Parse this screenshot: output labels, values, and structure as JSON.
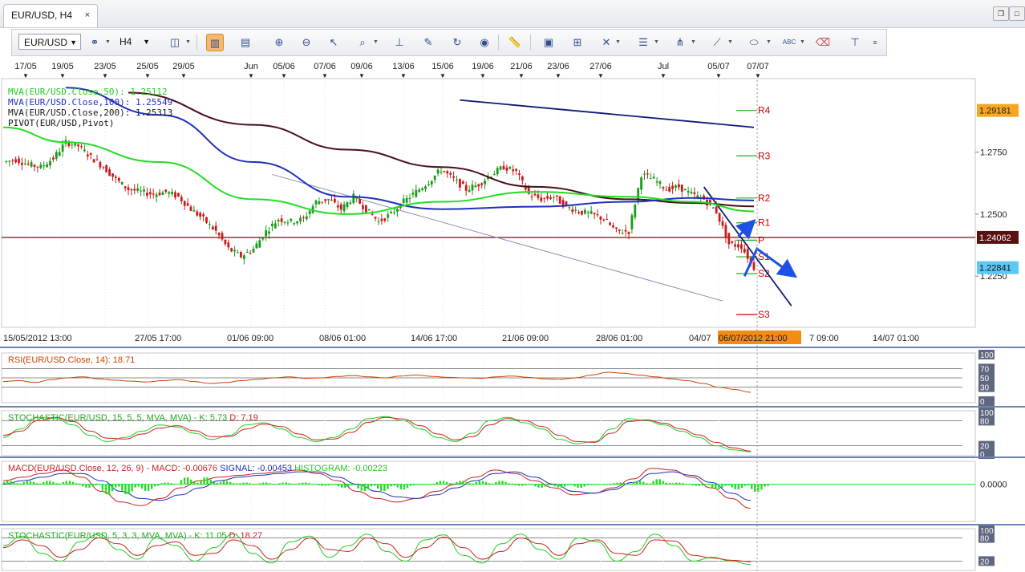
{
  "window": {
    "tab_title": "EUR/USD, H4",
    "close_glyph": "×"
  },
  "toolbar": {
    "symbol": "EUR/USD",
    "timeframe": "H4"
  },
  "colors": {
    "bull": "#1a9a1a",
    "bear": "#cc1a1a",
    "ma50": "#22dd22",
    "ma100": "#1f2fc0",
    "ma200": "#4a0f1a",
    "pivot_level": "#cc0000",
    "trend_dark": "#0c1a78",
    "arrow": "#1e50e6",
    "current_price_bg": "#5bc8f5",
    "pivot_price_bg": "#5a1010",
    "r4_price_bg": "#f6a623",
    "date_highlight": "#f28c14"
  },
  "chart_data": [
    {
      "type": "candlestick",
      "title": "EUR/USD, H4",
      "ylim": [
        1.205,
        1.304
      ],
      "x_axis_top_labels": [
        "17/05",
        "19/05",
        "23/05",
        "25/05",
        "29/05",
        "Jun",
        "05/06",
        "07/06",
        "09/06",
        "13/06",
        "15/06",
        "19/06",
        "21/06",
        "23/06",
        "27/06",
        "Jul",
        "05/07",
        "07/07"
      ],
      "x_axis_bottom_labels": [
        "15/05/2012 13:00",
        "27/05 17:00",
        "01/06 09:00",
        "08/06 01:00",
        "14/06 17:00",
        "21/06 09:00",
        "28/06 01:00",
        "04/07",
        "06/07/2012 21:00",
        "7 09:00",
        "14/07 01:00"
      ],
      "y_ticks": [
        "1.2750",
        "1.2500",
        "1.2250"
      ],
      "price_labels": {
        "r4_level": "1.29181",
        "pivot": "1.24062",
        "current": "1.22841"
      },
      "legend": [
        {
          "label": "MVA(EUR/USD.Close,50): 1.25112",
          "color": "#22cc22"
        },
        {
          "label": "MVA(EUR/USD.Close,100): 1.25549",
          "color": "#1f2fc0"
        },
        {
          "label": "MVA(EUR/USD.Close,200): 1.25313",
          "color": "#1a1a1a"
        },
        {
          "label": "PIVOT(EUR/USD,Pivot)",
          "color": "#111111"
        }
      ],
      "pivot_levels": [
        {
          "name": "R4",
          "value": 1.2918
        },
        {
          "name": "R3",
          "value": 1.2735
        },
        {
          "name": "R2",
          "value": 1.2565
        },
        {
          "name": "R1",
          "value": 1.2465
        },
        {
          "name": "P",
          "value": 1.2395
        },
        {
          "name": "S1",
          "value": 1.2328
        },
        {
          "name": "S2",
          "value": 1.226
        },
        {
          "name": "S3",
          "value": 1.2095
        }
      ],
      "close_path": [
        [
          0,
          1.271
        ],
        [
          4,
          1.272
        ],
        [
          8,
          1.27
        ],
        [
          12,
          1.269
        ],
        [
          16,
          1.2725
        ],
        [
          20,
          1.279
        ],
        [
          24,
          1.2775
        ],
        [
          28,
          1.273
        ],
        [
          32,
          1.269
        ],
        [
          36,
          1.264
        ],
        [
          40,
          1.26
        ],
        [
          44,
          1.259
        ],
        [
          48,
          1.258
        ],
        [
          52,
          1.259
        ],
        [
          56,
          1.257
        ],
        [
          60,
          1.252
        ],
        [
          64,
          1.248
        ],
        [
          68,
          1.243
        ],
        [
          72,
          1.236
        ],
        [
          76,
          1.233
        ],
        [
          80,
          1.236
        ],
        [
          84,
          1.243
        ],
        [
          88,
          1.248
        ],
        [
          92,
          1.247
        ],
        [
          96,
          1.248
        ],
        [
          100,
          1.255
        ],
        [
          104,
          1.256
        ],
        [
          108,
          1.252
        ],
        [
          112,
          1.257
        ],
        [
          116,
          1.252
        ],
        [
          120,
          1.247
        ],
        [
          124,
          1.25
        ],
        [
          128,
          1.255
        ],
        [
          132,
          1.259
        ],
        [
          136,
          1.263
        ],
        [
          140,
          1.268
        ],
        [
          144,
          1.264
        ],
        [
          148,
          1.26
        ],
        [
          152,
          1.262
        ],
        [
          156,
          1.266
        ],
        [
          160,
          1.269
        ],
        [
          164,
          1.267
        ],
        [
          168,
          1.258
        ],
        [
          172,
          1.256
        ],
        [
          176,
          1.257
        ],
        [
          180,
          1.253
        ],
        [
          184,
          1.251
        ],
        [
          188,
          1.25
        ],
        [
          192,
          1.248
        ],
        [
          196,
          1.243
        ],
        [
          200,
          1.243
        ],
        [
          204,
          1.266
        ],
        [
          208,
          1.264
        ],
        [
          212,
          1.26
        ],
        [
          216,
          1.261
        ],
        [
          220,
          1.258
        ],
        [
          224,
          1.256
        ],
        [
          228,
          1.251
        ],
        [
          232,
          1.238
        ],
        [
          236,
          1.237
        ],
        [
          240,
          1.2284
        ]
      ],
      "ma50_path": [
        [
          0,
          1.285
        ],
        [
          20,
          1.279
        ],
        [
          50,
          1.271
        ],
        [
          80,
          1.256
        ],
        [
          110,
          1.25
        ],
        [
          140,
          1.255
        ],
        [
          170,
          1.259
        ],
        [
          200,
          1.257
        ],
        [
          220,
          1.255
        ],
        [
          240,
          1.2511
        ]
      ],
      "ma100_path": [
        [
          20,
          1.301
        ],
        [
          50,
          1.29
        ],
        [
          80,
          1.271
        ],
        [
          110,
          1.257
        ],
        [
          140,
          1.252
        ],
        [
          170,
          1.253
        ],
        [
          200,
          1.255
        ],
        [
          220,
          1.2565
        ],
        [
          240,
          1.2555
        ]
      ],
      "ma200_path": [
        [
          40,
          1.299
        ],
        [
          80,
          1.286
        ],
        [
          110,
          1.276
        ],
        [
          140,
          1.269
        ],
        [
          170,
          1.261
        ],
        [
          200,
          1.256
        ],
        [
          220,
          1.2545
        ],
        [
          240,
          1.2531
        ]
      ],
      "annotations": [
        {
          "type": "line",
          "from": [
            86,
            1.266
          ],
          "to": [
            230,
            1.215
          ],
          "color": "#8892b0"
        },
        {
          "type": "line",
          "from": [
            146,
            1.296
          ],
          "to": [
            240,
            1.285
          ],
          "color": "#0c1a78"
        },
        {
          "type": "line",
          "from": [
            224,
            1.261
          ],
          "to": [
            252,
            1.213
          ],
          "color": "#0c1a78"
        },
        {
          "type": "arrow",
          "points": [
            [
              235,
              1.241
            ],
            [
              239,
              1.246
            ]
          ],
          "color": "#1e50e6"
        },
        {
          "type": "arrow",
          "points": [
            [
              237,
              1.225
            ],
            [
              241,
              1.236
            ],
            [
              252,
              1.226
            ]
          ],
          "color": "#1e50e6"
        }
      ]
    },
    {
      "type": "line",
      "title": "RSI(EUR/USD.Close, 14): 18.71",
      "color": "#cc4400",
      "ylim": [
        0,
        100
      ],
      "y_ticks": [
        "100",
        "70",
        "50",
        "30",
        "0"
      ],
      "levels": [
        70,
        50,
        30
      ],
      "values": [
        42,
        44,
        40,
        46,
        50,
        52,
        48,
        45,
        43,
        41,
        44,
        46,
        42,
        38,
        40,
        44,
        47,
        50,
        52,
        49,
        50,
        53,
        55,
        52,
        50,
        54,
        56,
        53,
        51,
        50,
        49,
        52,
        54,
        51,
        48,
        47,
        50,
        56,
        62,
        60,
        56,
        52,
        48,
        44,
        38,
        30,
        25,
        18.71
      ]
    },
    {
      "type": "line",
      "title_parts": {
        "name": "STOCHASTIC(EUR/USD, 15, 5, 5, MVA, MVA) - ",
        "k": "K: 5.73",
        "d": "D: 7.19"
      },
      "ylim": [
        0,
        100
      ],
      "y_ticks": [
        "100",
        "80",
        "20",
        "0"
      ],
      "levels": [
        80,
        20
      ],
      "series": [
        {
          "name": "K",
          "color": "#22cc22",
          "values": [
            40,
            60,
            88,
            85,
            70,
            45,
            30,
            40,
            55,
            70,
            65,
            50,
            35,
            45,
            70,
            75,
            60,
            40,
            30,
            40,
            60,
            85,
            90,
            80,
            60,
            40,
            30,
            50,
            80,
            88,
            75,
            60,
            35,
            25,
            30,
            60,
            85,
            80,
            70,
            55,
            40,
            20,
            10,
            5.73
          ]
        },
        {
          "name": "D",
          "color": "#cc2222",
          "values": [
            45,
            55,
            80,
            88,
            78,
            55,
            38,
            36,
            48,
            62,
            68,
            56,
            42,
            42,
            60,
            72,
            66,
            48,
            34,
            36,
            52,
            76,
            88,
            84,
            68,
            48,
            34,
            42,
            70,
            85,
            80,
            66,
            45,
            30,
            28,
            50,
            78,
            82,
            74,
            60,
            46,
            28,
            15,
            7.19
          ]
        }
      ]
    },
    {
      "type": "line",
      "title_parts": {
        "name": "MACD(EUR/USD.Close, 12, 26, 9) - ",
        "macd": "MACD: -0.00676",
        "signal": "SIGNAL: -0.00453",
        "hist": "HISTOGRAM: -0.00223"
      },
      "ylim": [
        -0.01,
        0.006
      ],
      "y_ticks": [
        "0.0000"
      ],
      "series": [
        {
          "name": "MACD",
          "color": "#cc2222",
          "values": [
            0.001,
            0.002,
            0.003,
            0.004,
            0.002,
            -0.002,
            -0.005,
            -0.006,
            -0.004,
            -0.001,
            0.001,
            0.002,
            0.0025,
            0.003,
            0.0035,
            0.004,
            0.003,
            0.001,
            -0.002,
            -0.004,
            -0.005,
            -0.004,
            -0.002,
            0.0,
            0.002,
            0.004,
            0.003,
            0.001,
            -0.001,
            -0.003,
            -0.0025,
            -0.001,
            0.0015,
            0.0045,
            0.004,
            0.002,
            -0.001,
            -0.004,
            -0.00676
          ]
        },
        {
          "name": "SIGNAL",
          "color": "#1f2fc0",
          "values": [
            0.0,
            0.001,
            0.002,
            0.003,
            0.003,
            0.001,
            -0.002,
            -0.004,
            -0.0045,
            -0.003,
            -0.001,
            0.001,
            0.002,
            0.0025,
            0.003,
            0.0035,
            0.0035,
            0.002,
            0.0,
            -0.002,
            -0.0035,
            -0.004,
            -0.003,
            -0.001,
            0.001,
            0.003,
            0.0035,
            0.002,
            0.0,
            -0.002,
            -0.0025,
            -0.0015,
            0.0005,
            0.003,
            0.0035,
            0.0025,
            0.0005,
            -0.0025,
            -0.00453
          ]
        },
        {
          "name": "HISTOGRAM",
          "color": "#22dd22",
          "values": [
            0.001,
            0.001,
            0.001,
            0.001,
            -0.001,
            -0.003,
            -0.003,
            -0.002,
            0.0005,
            0.002,
            0.002,
            0.001,
            0.0005,
            0.0005,
            0.0005,
            0.0005,
            -0.0005,
            -0.001,
            -0.002,
            -0.002,
            -0.0015,
            0.0,
            0.001,
            0.001,
            0.001,
            0.001,
            -0.0005,
            -0.001,
            -0.001,
            -0.001,
            0.0,
            0.0005,
            0.001,
            0.0015,
            0.0005,
            -0.0005,
            -0.0015,
            -0.0015,
            -0.00223
          ]
        }
      ]
    },
    {
      "type": "line",
      "title_parts": {
        "name": "STOCHASTIC(EUR/USD, 5, 3, 3, MVA, MVA) - ",
        "k": "K: 11.05",
        "d": "D: 18.27"
      },
      "ylim": [
        0,
        100
      ],
      "y_ticks": [
        "100",
        "80",
        "20"
      ],
      "levels": [
        80,
        20
      ],
      "series": [
        {
          "name": "K",
          "color": "#22cc22",
          "values": [
            60,
            85,
            40,
            20,
            70,
            90,
            50,
            25,
            80,
            60,
            20,
            55,
            90,
            40,
            15,
            70,
            85,
            30,
            60,
            90,
            45,
            20,
            75,
            88,
            35,
            15,
            65,
            90,
            50,
            25,
            80,
            70,
            20,
            45,
            90,
            60,
            20,
            30,
            20,
            11.05
          ]
        },
        {
          "name": "D",
          "color": "#cc2222",
          "values": [
            55,
            75,
            60,
            30,
            50,
            80,
            65,
            35,
            60,
            70,
            35,
            40,
            75,
            60,
            25,
            50,
            80,
            50,
            45,
            80,
            65,
            30,
            55,
            82,
            55,
            25,
            45,
            80,
            65,
            35,
            65,
            75,
            40,
            35,
            75,
            72,
            35,
            28,
            22,
            18.27
          ]
        }
      ]
    }
  ]
}
